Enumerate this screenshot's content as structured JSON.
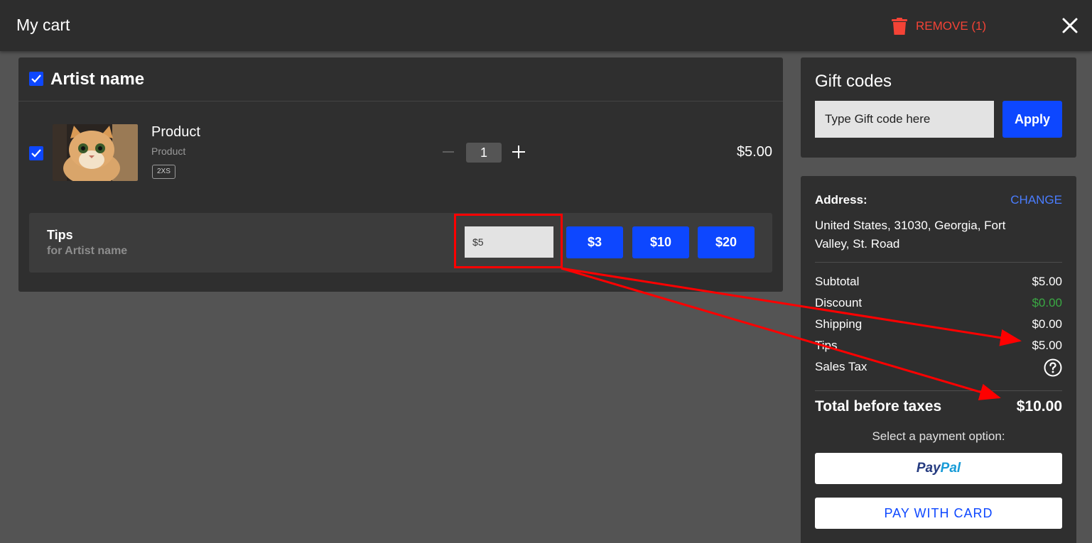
{
  "header": {
    "title": "My cart",
    "remove_label": "REMOVE (1)"
  },
  "cart": {
    "artist_name": "Artist name",
    "artist_checked": true,
    "product": {
      "name": "Product",
      "subtitle": "Product",
      "size": "2XS",
      "quantity": "1",
      "price": "$5.00",
      "checked": true
    },
    "tips": {
      "title": "Tips",
      "subtitle": "for Artist name",
      "input_value": "$5",
      "options": [
        "$3",
        "$10",
        "$20"
      ]
    }
  },
  "gift": {
    "title": "Gift codes",
    "placeholder": "Type Gift code here",
    "apply_label": "Apply"
  },
  "summary": {
    "address_label": "Address:",
    "change_label": "CHANGE",
    "address": "United States, 31030, Georgia, Fort Valley, St. Road",
    "rows": [
      {
        "label": "Subtotal",
        "value": "$5.00"
      },
      {
        "label": "Discount",
        "value": "$0.00"
      },
      {
        "label": "Shipping",
        "value": "$0.00"
      },
      {
        "label": "Tips",
        "value": "$5.00"
      },
      {
        "label": "Sales Tax",
        "value": ""
      }
    ],
    "total_label": "Total before taxes",
    "total_value": "$10.00",
    "payment_prompt": "Select a payment option:",
    "paypal_part1": "Pay",
    "paypal_part2": "Pal",
    "card_label": "PAY WITH CARD"
  },
  "colors": {
    "accent": "#0d47ff",
    "danger": "#f44336",
    "discount_green": "#3aa843",
    "annotation_red": "#ff0000"
  }
}
